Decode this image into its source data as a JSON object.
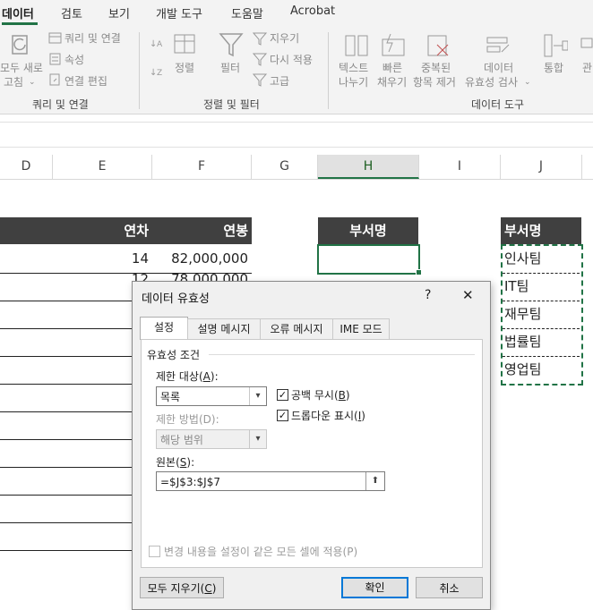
{
  "ribbon": {
    "tabs": [
      "데이터",
      "검토",
      "보기",
      "개발 도구",
      "도움말",
      "Acrobat"
    ],
    "active_tab": "데이터",
    "refresh_all_line1": "모두 새로",
    "refresh_all_line2": "고침",
    "queries_connections": "쿼리 및 연결",
    "properties": "속성",
    "edit_links": "연결 편집",
    "group_queries": "쿼리 및 연결",
    "sort": "정렬",
    "filter": "필터",
    "clear": "지우기",
    "reapply": "다시 적용",
    "advanced": "고급",
    "group_sort_filter": "정렬 및 필터",
    "text_to_columns_line1": "텍스트",
    "text_to_columns_line2": "나누기",
    "flash_fill_line1": "빠른",
    "flash_fill_line2": "채우기",
    "remove_dup_line1": "중복된",
    "remove_dup_line2": "항목 제거",
    "data_validation_line1": "데이터",
    "data_validation_line2": "유효성 검사",
    "consolidate": "통합",
    "relations": "관",
    "group_data_tools": "데이터 도구"
  },
  "columns": [
    "D",
    "E",
    "F",
    "G",
    "H",
    "I",
    "J"
  ],
  "selected_column": "H",
  "sheet": {
    "header_year": "연차",
    "header_salary": "연봉",
    "row1_year": "14",
    "row1_salary": "82,000,000",
    "row2_year_partial": "12",
    "row2_salary_partial": "78,000,000",
    "dept_header_h": "부서명",
    "dept_header_j": "부서명",
    "dept_list": [
      "인사팀",
      "IT팀",
      "재무팀",
      "법률팀",
      "영업팀"
    ]
  },
  "dialog": {
    "title": "데이터 유효성",
    "help": "?",
    "close": "✕",
    "tabs": [
      "설정",
      "설명 메시지",
      "오류 메시지",
      "IME 모드"
    ],
    "active_tab": "설정",
    "section": "유효성 조건",
    "allow_label": "제한 대상(",
    "allow_key": "A",
    "allow_value": "목록",
    "ignore_blank": "공백 무시(",
    "ignore_blank_key": "B",
    "ignore_blank_checked": true,
    "dropdown": "드롭다운 표시(",
    "dropdown_key": "I",
    "dropdown_checked": true,
    "method_label": "제한 방법(D):",
    "method_value": "해당 범위",
    "source_label": "원본(",
    "source_key": "S",
    "source_value": "=$J$3:$J$7",
    "apply_all": "변경 내용을 설정이 같은 모든 셀에 적용(P)",
    "apply_all_checked": false,
    "clear_all": "모두 지우기(",
    "clear_all_key": "C",
    "ok": "확인",
    "cancel": "취소"
  }
}
